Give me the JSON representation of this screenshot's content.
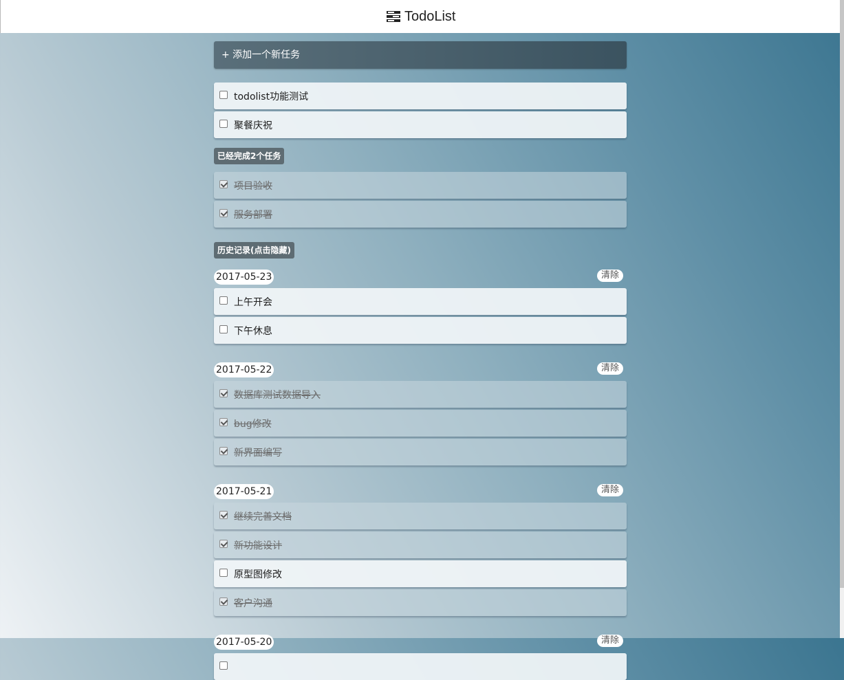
{
  "header": {
    "title": "TodoList",
    "icon": "list-icon"
  },
  "add_task": {
    "label": "+ 添加一个新任务"
  },
  "pending": [
    {
      "text": "todolist功能测试",
      "done": false
    },
    {
      "text": "聚餐庆祝",
      "done": false
    }
  ],
  "completed_tag": "已经完成2个任务",
  "completed": [
    {
      "text": "项目验收",
      "done": true
    },
    {
      "text": "服务部署",
      "done": true
    }
  ],
  "history_tag": "历史记录(点击隐藏)",
  "history": [
    {
      "date": "2017-05-23",
      "clear_label": "清除",
      "items": [
        {
          "text": "上午开会",
          "done": false
        },
        {
          "text": "下午休息",
          "done": false
        }
      ]
    },
    {
      "date": "2017-05-22",
      "clear_label": "清除",
      "items": [
        {
          "text": "数据库测试数据导入",
          "done": true
        },
        {
          "text": "bug修改",
          "done": true
        },
        {
          "text": "新界面编写",
          "done": true
        }
      ]
    },
    {
      "date": "2017-05-21",
      "clear_label": "清除",
      "items": [
        {
          "text": "继续完善文档",
          "done": true
        },
        {
          "text": "新功能设计",
          "done": true
        },
        {
          "text": "原型图修改",
          "done": false
        },
        {
          "text": "客户沟通",
          "done": true
        }
      ]
    },
    {
      "date": "2017-05-20",
      "clear_label": "清除",
      "items": [
        {
          "text": "",
          "done": false
        }
      ]
    }
  ]
}
